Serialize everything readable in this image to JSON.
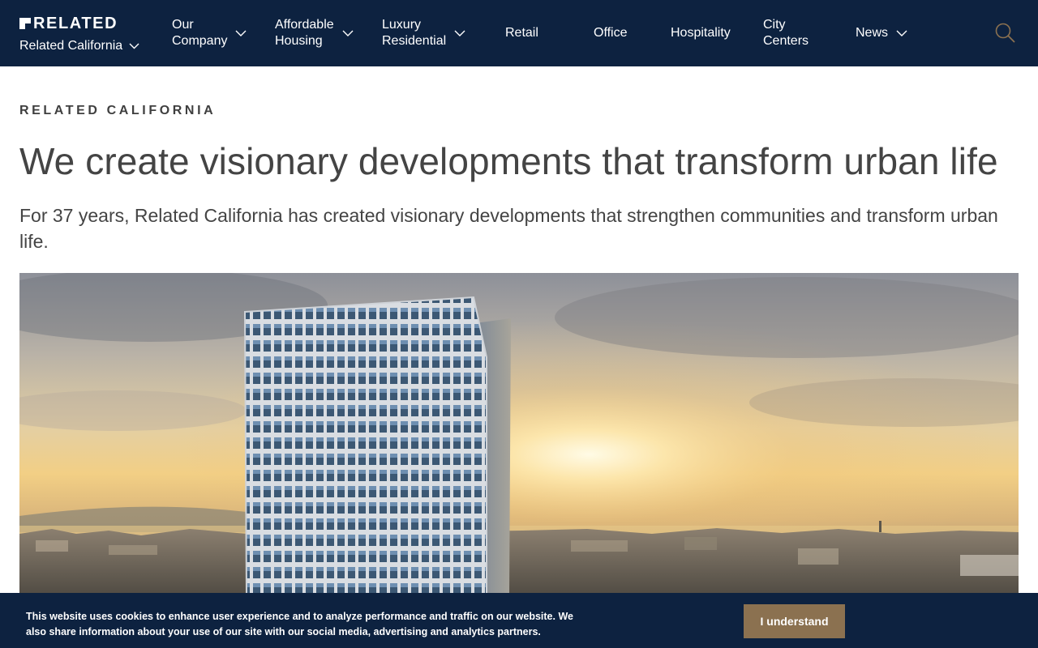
{
  "brand": {
    "logo_text": "RELATED",
    "region_label": "Related California"
  },
  "nav": {
    "items": [
      {
        "label": "Our\nCompany",
        "dropdown": true
      },
      {
        "label": "Affordable\nHousing",
        "dropdown": true
      },
      {
        "label": "Luxury\nResidential",
        "dropdown": true
      },
      {
        "label": "Retail",
        "dropdown": false
      },
      {
        "label": "Office",
        "dropdown": false
      },
      {
        "label": "Hospitality",
        "dropdown": false
      },
      {
        "label": "City\nCenters",
        "dropdown": false
      },
      {
        "label": "News",
        "dropdown": true
      }
    ],
    "search_icon": "search-icon"
  },
  "main": {
    "eyebrow": "RELATED CALIFORNIA",
    "headline": "We create visionary developments that transform urban life",
    "lede": "For 37 years, Related California has created visionary developments that strengthen communities and transform urban life."
  },
  "cookie": {
    "text": "This website uses cookies to enhance user experience and to analyze performance and traffic on our website. We also share information about your use of our site with our social media, advertising and analytics partners.",
    "button_label": "I understand"
  },
  "colors": {
    "nav_bg": "#0d2240",
    "text": "#444444",
    "search_accent": "#8b7150",
    "button_bg": "#8b7150"
  }
}
